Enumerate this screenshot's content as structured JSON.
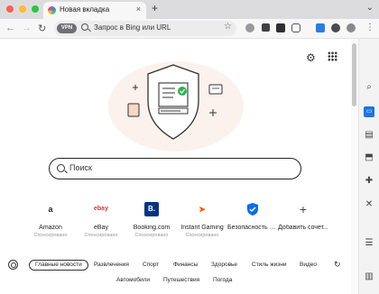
{
  "tab": {
    "title": "Новая вкладка",
    "close": "×",
    "new": "+"
  },
  "toolbar": {
    "back": "←",
    "forward": "→",
    "reload": "↻",
    "vpn": "VPN",
    "address_placeholder": "Запрос в Bing или URL",
    "star": "☆",
    "menu": "⋮"
  },
  "search": {
    "placeholder": "Поиск"
  },
  "tiles": [
    {
      "name": "Amazon",
      "sub": "Спонсировано",
      "icon": "a",
      "color": "#ff9900"
    },
    {
      "name": "eBay",
      "sub": "Спонсировано",
      "icon": "ebay",
      "color": "#e53238"
    },
    {
      "name": "Booking.com",
      "sub": "Спонсировано",
      "icon": "B.",
      "color": "#003580"
    },
    {
      "name": "Instant Gaming",
      "sub": "Спонсировано",
      "icon": "➤",
      "color": "#ff5400"
    },
    {
      "name": "Безопасность и...",
      "sub": "",
      "icon": "shield-check",
      "color": "#0a6cf0"
    },
    {
      "name": "Добавить сочет...",
      "sub": "",
      "icon": "+",
      "color": "#444444"
    }
  ],
  "feed": {
    "row1": [
      "Главные новости",
      "Развлечения",
      "Спорт",
      "Финансы",
      "Здоровье",
      "Стиль жизни",
      "Видео"
    ],
    "row2": [
      "Автомобили",
      "Путешествия",
      "Погода"
    ]
  },
  "colors": {
    "accent": "#0a6cf0",
    "hero_check": "#2eb34a",
    "hero_bg": "#fbf2ee"
  }
}
